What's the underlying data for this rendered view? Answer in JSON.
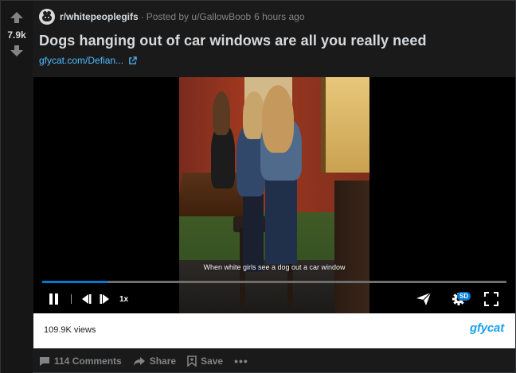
{
  "post": {
    "score": "7.9k",
    "subreddit": "r/whitepeoplegifs",
    "separator": "·",
    "posted_by_prefix": "Posted by",
    "author": "u/GallowBoob",
    "time": "6 hours ago",
    "title": "Dogs hanging out of car windows are all you really need",
    "link_text": "gfycat.com/Defian..."
  },
  "video": {
    "caption": "When white girls see a dog out a car window",
    "progress": 0.14,
    "speed_label": "1x",
    "quality_badge": "SD"
  },
  "stats": {
    "views": "109.9K views",
    "logo_text": "gfycat"
  },
  "actions": {
    "comments": "114 Comments",
    "share": "Share",
    "save": "Save",
    "more": "•••"
  },
  "colors": {
    "background": "#1a1a1b",
    "text": "#d7dadc",
    "muted": "#818384",
    "link": "#4fbcff",
    "progress": "#0079d3"
  },
  "icons": [
    "upvote-icon",
    "downvote-icon",
    "subreddit-avatar-icon",
    "external-link-icon",
    "pause-icon",
    "rewind-icon",
    "forward-icon",
    "send-icon",
    "settings-icon",
    "fullscreen-icon",
    "comment-icon",
    "share-icon",
    "save-icon"
  ]
}
